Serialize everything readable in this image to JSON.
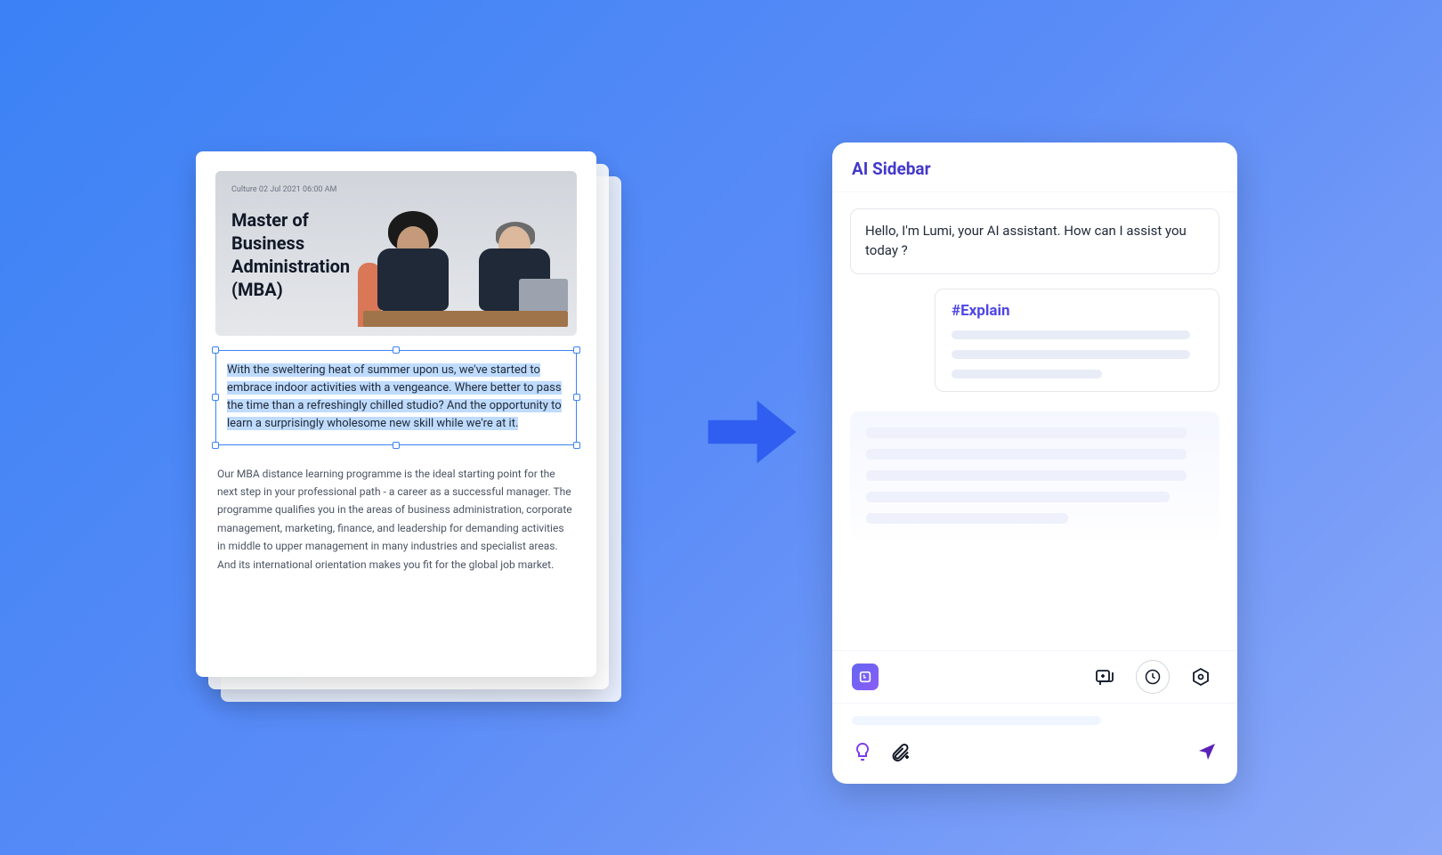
{
  "document": {
    "meta": "Culture 02 Jul 2021 06:00 AM",
    "title": "Master of Business Administration (MBA)",
    "selected_text": "With the sweltering heat of summer upon us, we've started to embrace indoor activities with a vengeance. Where better to pass the time than a refreshingly chilled studio? And the opportunity to learn a surprisingly wholesome new skill while we're at it.",
    "body_text": "Our MBA distance learning programme is the ideal starting point for the next step in your professional path - a career as a successful manager. The programme qualifies you in the areas of business administration, corporate management, marketing, finance, and leadership for demanding activities in middle to upper management in many industries and specialist areas. And its international orientation makes you fit for the global job market."
  },
  "sidebar": {
    "title": "AI Sidebar",
    "greeting": "Hello, I'm Lumi, your AI assistant. How can I assist you today ?",
    "command": "#Explain"
  },
  "colors": {
    "accent": "#4f46e5",
    "selection": "#bfdbfe"
  }
}
